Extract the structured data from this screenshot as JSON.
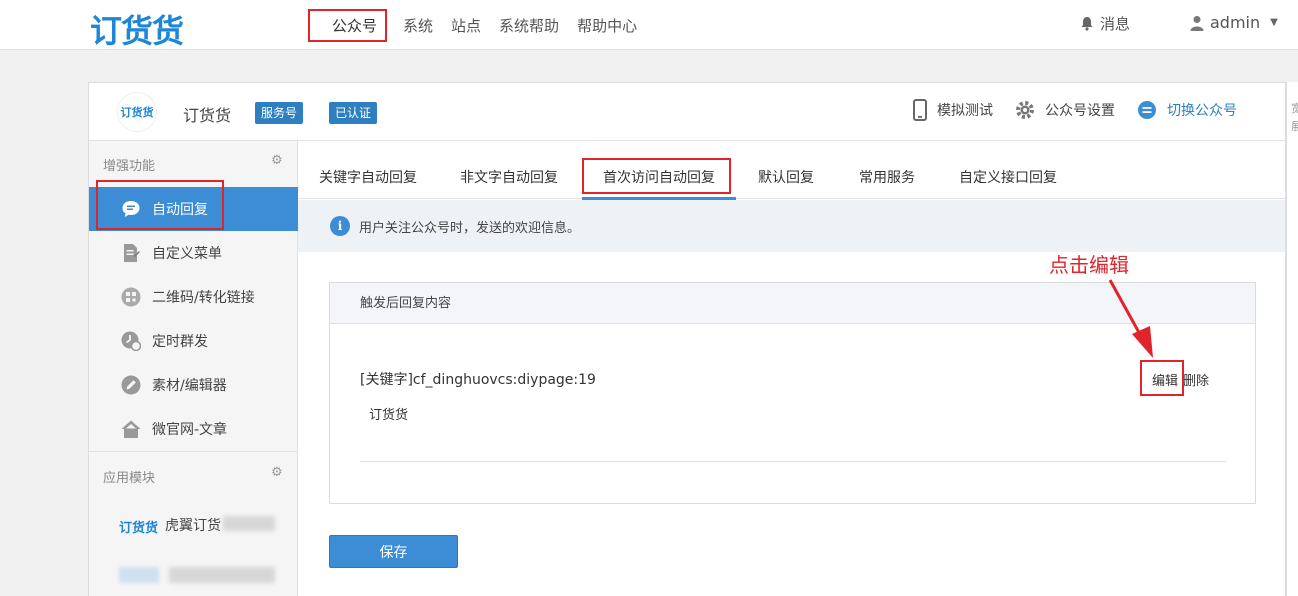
{
  "topbar": {
    "logo": "订货货",
    "nav": [
      "公众号",
      "系统",
      "站点",
      "系统帮助",
      "帮助中心"
    ],
    "messages_label": "消息",
    "user_name": "admin"
  },
  "account": {
    "avatar_text": "订货货",
    "name": "订货货",
    "badge_service": "服务号",
    "badge_verified": "已认证",
    "actions": {
      "simulate": "模拟测试",
      "settings": "公众号设置",
      "switch": "切换公众号"
    }
  },
  "sidebar": {
    "group_enhance": "增强功能",
    "items": [
      {
        "label": "自动回复",
        "icon": "chat-bubble-icon"
      },
      {
        "label": "自定义菜单",
        "icon": "document-edit-icon"
      },
      {
        "label": "二维码/转化链接",
        "icon": "qrcode-icon"
      },
      {
        "label": "定时群发",
        "icon": "clock-icon"
      },
      {
        "label": "素材/编辑器",
        "icon": "pencil-icon"
      },
      {
        "label": "微官网-文章",
        "icon": "home-icon"
      }
    ],
    "group_apps": "应用模块",
    "app_logo": "订货货",
    "app_name": "虎翼订货"
  },
  "tabs": [
    "关键字自动回复",
    "非文字自动回复",
    "首次访问自动回复",
    "默认回复",
    "常用服务",
    "自定义接口回复"
  ],
  "info": "用户关注公众号时，发送的欢迎信息。",
  "annotation": "点击编辑",
  "reply": {
    "header": "触发后回复内容",
    "keyword": "[关键字]cf_dinghuovcs:diypage:19",
    "text": "订货货",
    "edit": "编辑",
    "delete": "删除"
  },
  "save_label": "保存",
  "right_strip": [
    "宽",
    "展"
  ],
  "colors": {
    "accent": "#3c8dd5",
    "brand": "#1e86d8",
    "highlight": "#e0242b"
  }
}
